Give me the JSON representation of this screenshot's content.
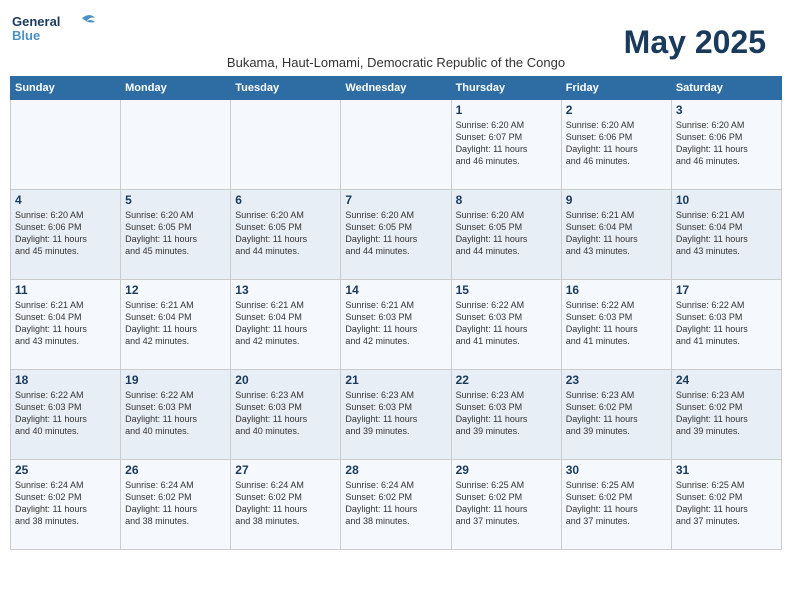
{
  "logo": {
    "line1": "General",
    "line2": "Blue"
  },
  "title": "May 2025",
  "subtitle": "Bukama, Haut-Lomami, Democratic Republic of the Congo",
  "days_header": [
    "Sunday",
    "Monday",
    "Tuesday",
    "Wednesday",
    "Thursday",
    "Friday",
    "Saturday"
  ],
  "weeks": [
    {
      "days": [
        {
          "num": "",
          "info": ""
        },
        {
          "num": "",
          "info": ""
        },
        {
          "num": "",
          "info": ""
        },
        {
          "num": "",
          "info": ""
        },
        {
          "num": "1",
          "info": "Sunrise: 6:20 AM\nSunset: 6:07 PM\nDaylight: 11 hours\nand 46 minutes."
        },
        {
          "num": "2",
          "info": "Sunrise: 6:20 AM\nSunset: 6:06 PM\nDaylight: 11 hours\nand 46 minutes."
        },
        {
          "num": "3",
          "info": "Sunrise: 6:20 AM\nSunset: 6:06 PM\nDaylight: 11 hours\nand 46 minutes."
        }
      ]
    },
    {
      "days": [
        {
          "num": "4",
          "info": "Sunrise: 6:20 AM\nSunset: 6:06 PM\nDaylight: 11 hours\nand 45 minutes."
        },
        {
          "num": "5",
          "info": "Sunrise: 6:20 AM\nSunset: 6:05 PM\nDaylight: 11 hours\nand 45 minutes."
        },
        {
          "num": "6",
          "info": "Sunrise: 6:20 AM\nSunset: 6:05 PM\nDaylight: 11 hours\nand 44 minutes."
        },
        {
          "num": "7",
          "info": "Sunrise: 6:20 AM\nSunset: 6:05 PM\nDaylight: 11 hours\nand 44 minutes."
        },
        {
          "num": "8",
          "info": "Sunrise: 6:20 AM\nSunset: 6:05 PM\nDaylight: 11 hours\nand 44 minutes."
        },
        {
          "num": "9",
          "info": "Sunrise: 6:21 AM\nSunset: 6:04 PM\nDaylight: 11 hours\nand 43 minutes."
        },
        {
          "num": "10",
          "info": "Sunrise: 6:21 AM\nSunset: 6:04 PM\nDaylight: 11 hours\nand 43 minutes."
        }
      ]
    },
    {
      "days": [
        {
          "num": "11",
          "info": "Sunrise: 6:21 AM\nSunset: 6:04 PM\nDaylight: 11 hours\nand 43 minutes."
        },
        {
          "num": "12",
          "info": "Sunrise: 6:21 AM\nSunset: 6:04 PM\nDaylight: 11 hours\nand 42 minutes."
        },
        {
          "num": "13",
          "info": "Sunrise: 6:21 AM\nSunset: 6:04 PM\nDaylight: 11 hours\nand 42 minutes."
        },
        {
          "num": "14",
          "info": "Sunrise: 6:21 AM\nSunset: 6:03 PM\nDaylight: 11 hours\nand 42 minutes."
        },
        {
          "num": "15",
          "info": "Sunrise: 6:22 AM\nSunset: 6:03 PM\nDaylight: 11 hours\nand 41 minutes."
        },
        {
          "num": "16",
          "info": "Sunrise: 6:22 AM\nSunset: 6:03 PM\nDaylight: 11 hours\nand 41 minutes."
        },
        {
          "num": "17",
          "info": "Sunrise: 6:22 AM\nSunset: 6:03 PM\nDaylight: 11 hours\nand 41 minutes."
        }
      ]
    },
    {
      "days": [
        {
          "num": "18",
          "info": "Sunrise: 6:22 AM\nSunset: 6:03 PM\nDaylight: 11 hours\nand 40 minutes."
        },
        {
          "num": "19",
          "info": "Sunrise: 6:22 AM\nSunset: 6:03 PM\nDaylight: 11 hours\nand 40 minutes."
        },
        {
          "num": "20",
          "info": "Sunrise: 6:23 AM\nSunset: 6:03 PM\nDaylight: 11 hours\nand 40 minutes."
        },
        {
          "num": "21",
          "info": "Sunrise: 6:23 AM\nSunset: 6:03 PM\nDaylight: 11 hours\nand 39 minutes."
        },
        {
          "num": "22",
          "info": "Sunrise: 6:23 AM\nSunset: 6:03 PM\nDaylight: 11 hours\nand 39 minutes."
        },
        {
          "num": "23",
          "info": "Sunrise: 6:23 AM\nSunset: 6:02 PM\nDaylight: 11 hours\nand 39 minutes."
        },
        {
          "num": "24",
          "info": "Sunrise: 6:23 AM\nSunset: 6:02 PM\nDaylight: 11 hours\nand 39 minutes."
        }
      ]
    },
    {
      "days": [
        {
          "num": "25",
          "info": "Sunrise: 6:24 AM\nSunset: 6:02 PM\nDaylight: 11 hours\nand 38 minutes."
        },
        {
          "num": "26",
          "info": "Sunrise: 6:24 AM\nSunset: 6:02 PM\nDaylight: 11 hours\nand 38 minutes."
        },
        {
          "num": "27",
          "info": "Sunrise: 6:24 AM\nSunset: 6:02 PM\nDaylight: 11 hours\nand 38 minutes."
        },
        {
          "num": "28",
          "info": "Sunrise: 6:24 AM\nSunset: 6:02 PM\nDaylight: 11 hours\nand 38 minutes."
        },
        {
          "num": "29",
          "info": "Sunrise: 6:25 AM\nSunset: 6:02 PM\nDaylight: 11 hours\nand 37 minutes."
        },
        {
          "num": "30",
          "info": "Sunrise: 6:25 AM\nSunset: 6:02 PM\nDaylight: 11 hours\nand 37 minutes."
        },
        {
          "num": "31",
          "info": "Sunrise: 6:25 AM\nSunset: 6:02 PM\nDaylight: 11 hours\nand 37 minutes."
        }
      ]
    }
  ]
}
